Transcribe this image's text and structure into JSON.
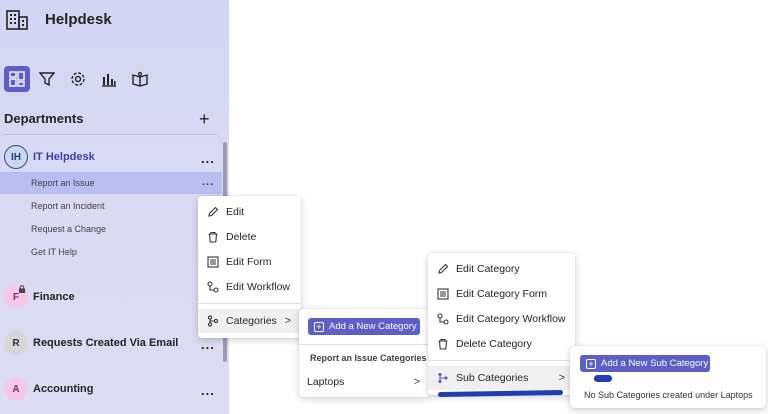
{
  "app": {
    "title": "Helpdesk"
  },
  "toolbar": {
    "icons": [
      "dashboard-icon",
      "filter-icon",
      "settings-icon",
      "reports-icon",
      "knowledge-base-icon"
    ]
  },
  "departments": {
    "header": "Departments",
    "add_label": "+",
    "items": [
      {
        "initials": "IH",
        "name": "IT Helpdesk",
        "more": "...",
        "avatar_color": "#c9d7ef"
      },
      {
        "initials": "F",
        "name": "Finance",
        "more": "",
        "avatar_color": "#f4c8e6"
      },
      {
        "initials": "R",
        "name": "Requests Created Via Email",
        "more": "...",
        "avatar_color": "#d6d6d6"
      },
      {
        "initials": "A",
        "name": "Accounting",
        "more": "...",
        "avatar_color": "#f4c8e6"
      }
    ],
    "it_sub_items": [
      {
        "label": "Report an Issue",
        "more": "..."
      },
      {
        "label": "Report an Incident"
      },
      {
        "label": "Request a Change"
      },
      {
        "label": "Get IT Help"
      }
    ]
  },
  "context_menu": {
    "items": [
      {
        "label": "Edit",
        "icon": "pencil-icon"
      },
      {
        "label": "Delete",
        "icon": "trash-icon"
      },
      {
        "label": "Edit Form",
        "icon": "form-icon"
      },
      {
        "label": "Edit Workflow",
        "icon": "workflow-icon"
      },
      {
        "label": "Categories",
        "icon": "branch-icon",
        "chevron": ">"
      }
    ]
  },
  "categories_panel": {
    "add_button": "Add a New Category",
    "heading": "Report an Issue Categories",
    "items": [
      {
        "label": "Laptops",
        "chevron": ">"
      }
    ]
  },
  "category_menu": {
    "items": [
      {
        "label": "Edit Category",
        "icon": "pencil-icon"
      },
      {
        "label": "Edit Category Form",
        "icon": "form-icon"
      },
      {
        "label": "Edit Category Workflow",
        "icon": "workflow-icon"
      },
      {
        "label": "Delete Category",
        "icon": "trash-icon"
      },
      {
        "label": "Sub Categories",
        "icon": "branch-icon",
        "chevron": ">"
      }
    ]
  },
  "subcategory_panel": {
    "add_button": "Add a New Sub Category",
    "empty_text": "No Sub Categories created under Laptops"
  },
  "colors": {
    "accent": "#5b5fc7",
    "sidebar": "#d9d9f3",
    "selected": "#b9bdf1"
  }
}
